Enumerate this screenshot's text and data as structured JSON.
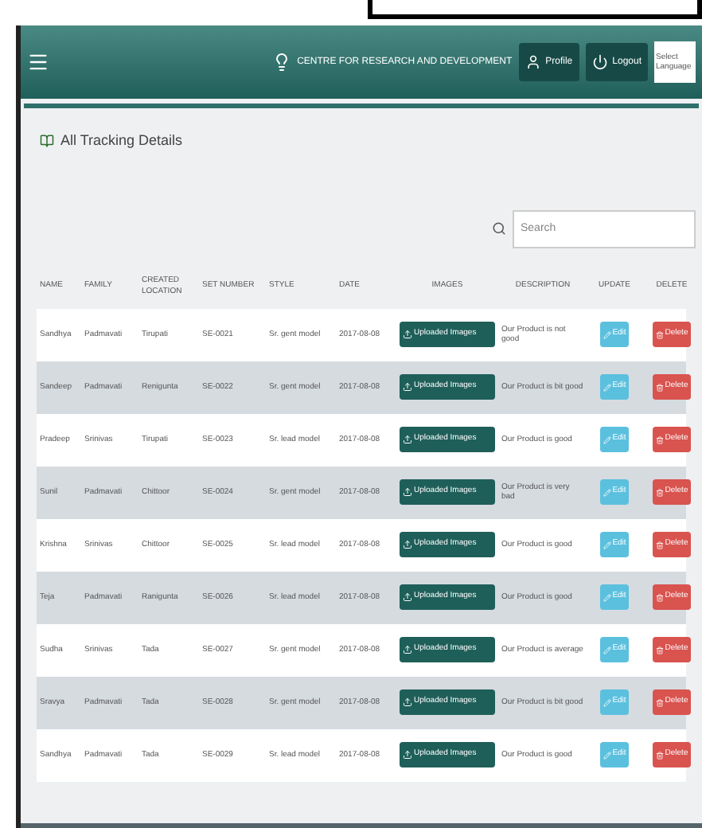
{
  "header": {
    "brand": "CENTRE FOR RESEARCH AND DEVELOPMENT",
    "buttons": [
      "Profile",
      "Logout"
    ],
    "language": "Select Language"
  },
  "page_title": "All Tracking Details",
  "search": {
    "placeholder": "Search"
  },
  "table": {
    "columns": [
      "NAME",
      "FAMILY",
      "CREATED LOCATION",
      "SET NUMBER",
      "STYLE",
      "DATE",
      "IMAGES",
      "DESCRIPTION",
      "UPDATE",
      "DELETE"
    ],
    "rows": [
      {
        "cells": [
          "Sandhya",
          "Padmavati",
          "Tirupati",
          "SE-0021",
          "Sr. gent model",
          "2017-08-08"
        ],
        "images": "Uploaded Images",
        "description": "Our Product is not good",
        "update": "Edit",
        "delete": "Delete"
      },
      {
        "cells": [
          "Sandeep",
          "Padmavati",
          "Renigunta",
          "SE-0022",
          "Sr. gent model",
          "2017-08-08"
        ],
        "images": "Uploaded Images",
        "description": "Our Product is bit good",
        "update": "Edit",
        "delete": "Delete"
      },
      {
        "cells": [
          "Pradeep",
          "Srinivas",
          "Tirupati",
          "SE-0023",
          "Sr. lead model",
          "2017-08-08"
        ],
        "images": "Uploaded Images",
        "description": "Our Product is good",
        "update": "Edit",
        "delete": "Delete"
      },
      {
        "cells": [
          "Sunil",
          "Padmavati",
          "Chittoor",
          "SE-0024",
          "Sr. gent model",
          "2017-08-08"
        ],
        "images": "Uploaded Images",
        "description": "Our Product is very bad",
        "update": "Edit",
        "delete": "Delete"
      },
      {
        "cells": [
          "Krishna",
          "Srinivas",
          "Chittoor",
          "SE-0025",
          "Sr. lead model",
          "2017-08-08"
        ],
        "images": "Uploaded Images",
        "description": "Our Product is good",
        "update": "Edit",
        "delete": "Delete"
      },
      {
        "cells": [
          "Teja",
          "Padmavati",
          "Ranigunta",
          "SE-0026",
          "Sr. lead model",
          "2017-08-08"
        ],
        "images": "Uploaded Images",
        "description": "Our Product is good",
        "update": "Edit",
        "delete": "Delete"
      },
      {
        "cells": [
          "Sudha",
          "Srinivas",
          "Tada",
          "SE-0027",
          "Sr. gent model",
          "2017-08-08"
        ],
        "images": "Uploaded Images",
        "description": "Our Product is average",
        "update": "Edit",
        "delete": "Delete"
      },
      {
        "cells": [
          "Sravya",
          "Padmavati",
          "Tada",
          "SE-0028",
          "Sr. gent model",
          "2017-08-08"
        ],
        "images": "Uploaded Images",
        "description": "Our Product is bit good",
        "update": "Edit",
        "delete": "Delete"
      },
      {
        "cells": [
          "Sandhya",
          "Padmavati",
          "Tada",
          "SE-0029",
          "Sr. lead model",
          "2017-08-08"
        ],
        "images": "Uploaded Images",
        "description": "Our Product is good",
        "update": "Edit",
        "delete": "Delete"
      }
    ]
  }
}
